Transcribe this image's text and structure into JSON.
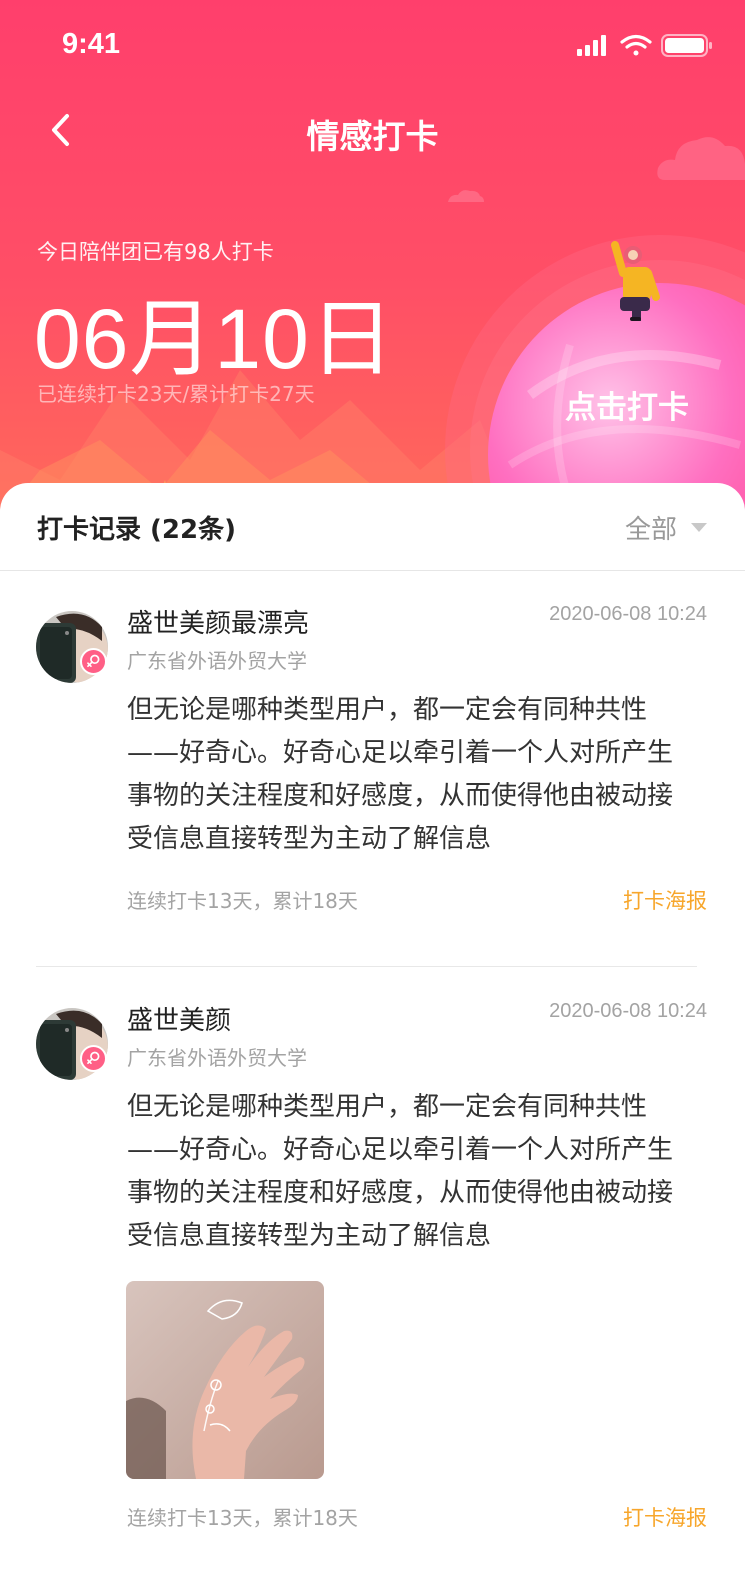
{
  "status_bar": {
    "time": "9:41"
  },
  "nav": {
    "title": "情感打卡"
  },
  "hero": {
    "summary": "今日陪伴团已有98人打卡",
    "date": "06月10日",
    "streak": "已连续打卡23天/累计打卡27天",
    "checkin_label": "点击打卡"
  },
  "records": {
    "title": "打卡记录 (22条)",
    "filter_label": "全部"
  },
  "entries": [
    {
      "name": "盛世美颜最漂亮",
      "school": "广东省外语外贸大学",
      "time": "2020-06-08 10:24",
      "content": "但无论是哪种类型用户，都一定会有同种共性——好奇心。好奇心足以牵引着一个人对所产生事物的关注程度和好感度，从而使得他由被动接受信息直接转型为主动了解信息",
      "stats": "连续打卡13天，累计18天",
      "poster_label": "打卡海报"
    },
    {
      "name": "盛世美颜",
      "school": "广东省外语外贸大学",
      "time": "2020-06-08 10:24",
      "content": "但无论是哪种类型用户，都一定会有同种共性——好奇心。好奇心足以牵引着一个人对所产生事物的关注程度和好感度，从而使得他由被动接受信息直接转型为主动了解信息",
      "stats": "连续打卡13天，累计18天",
      "poster_label": "打卡海报"
    }
  ],
  "colors": {
    "hero_top": "#ff3f6c",
    "hero_bottom": "#ff6a5a",
    "accent_orange": "#f7a62b",
    "gender_badge": "#ff5f86"
  },
  "icons": [
    "back-arrow-icon",
    "cellular-signal-icon",
    "wifi-icon",
    "battery-icon",
    "female-icon",
    "dropdown-caret-icon"
  ]
}
